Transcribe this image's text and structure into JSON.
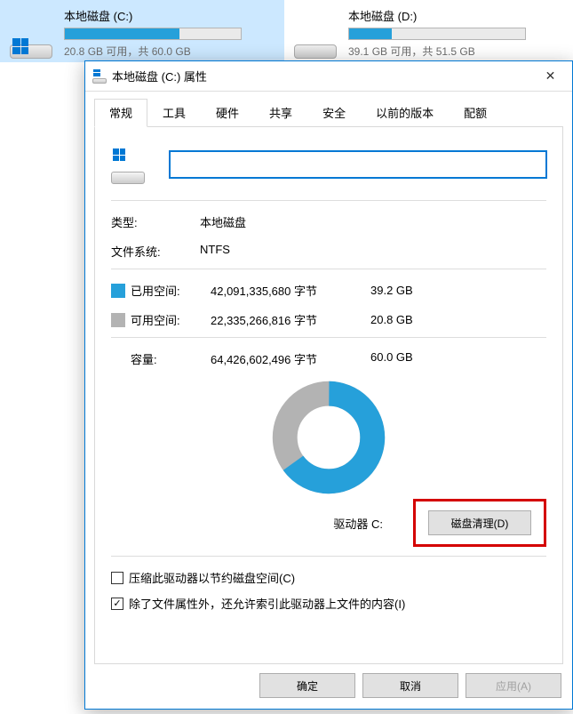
{
  "explorer": {
    "drives": [
      {
        "name": "本地磁盘 (C:)",
        "sub": "20.8 GB 可用，共 60.0 GB",
        "fill_pct": 65,
        "selected": true,
        "has_logo": true
      },
      {
        "name": "本地磁盘 (D:)",
        "sub": "39.1 GB 可用，共 51.5 GB",
        "fill_pct": 24,
        "selected": false,
        "has_logo": false
      }
    ]
  },
  "dialog": {
    "title": "本地磁盘 (C:) 属性",
    "tabs": [
      "常规",
      "工具",
      "硬件",
      "共享",
      "安全",
      "以前的版本",
      "配额"
    ],
    "active_tab": 0,
    "name_value": "",
    "type_label": "类型:",
    "type_value": "本地磁盘",
    "fs_label": "文件系统:",
    "fs_value": "NTFS",
    "used_label": "已用空间:",
    "used_bytes": "42,091,335,680 字节",
    "used_readable": "39.2 GB",
    "free_label": "可用空间:",
    "free_bytes": "22,335,266,816 字节",
    "free_readable": "20.8 GB",
    "capacity_label": "容量:",
    "capacity_bytes": "64,426,602,496 字节",
    "capacity_readable": "60.0 GB",
    "drive_label": "驱动器 C:",
    "cleanup_btn": "磁盘清理(D)",
    "checkbox_compress": "压缩此驱动器以节约磁盘空间(C)",
    "checkbox_index": "除了文件属性外，还允许索引此驱动器上文件的内容(I)",
    "compress_checked": false,
    "index_checked": true,
    "btn_ok": "确定",
    "btn_cancel": "取消",
    "btn_apply": "应用(A)",
    "colors": {
      "used": "#26a0da",
      "free": "#b3b3b3"
    },
    "used_pct": 65
  },
  "chart_data": {
    "type": "pie",
    "title": "驱动器 C:",
    "series": [
      {
        "name": "已用空间",
        "value": 42091335680,
        "readable": "39.2 GB",
        "color": "#26a0da"
      },
      {
        "name": "可用空间",
        "value": 22335266816,
        "readable": "20.8 GB",
        "color": "#b3b3b3"
      }
    ],
    "total": 64426602496
  }
}
